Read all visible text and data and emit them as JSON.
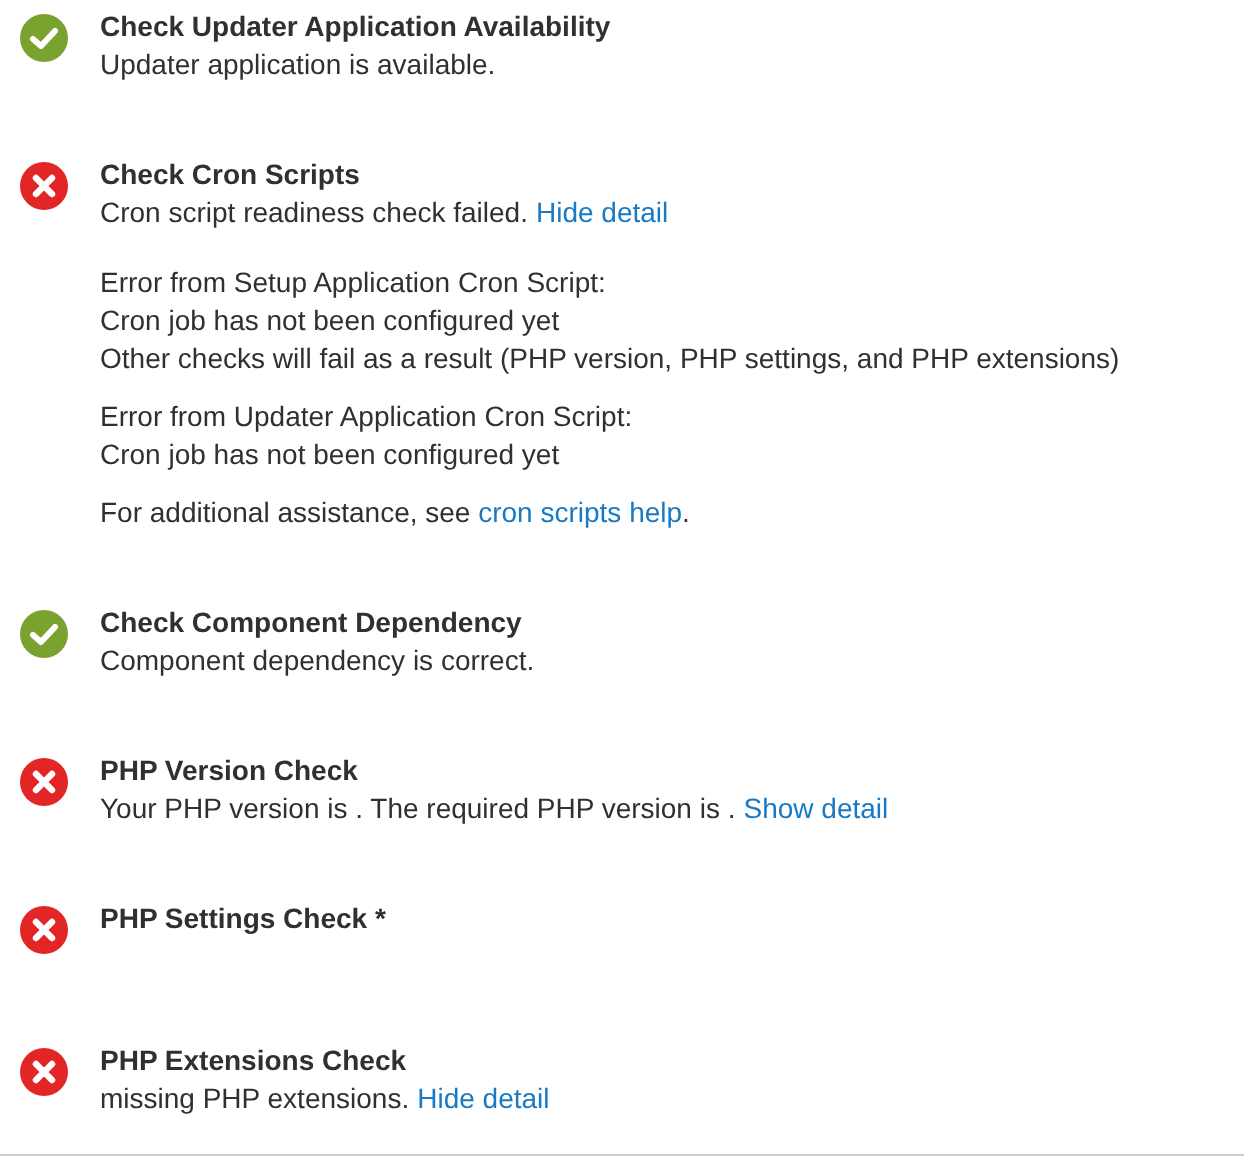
{
  "checks": [
    {
      "kind": "pass",
      "title": "Check Updater Application Availability",
      "message": "Updater application is available."
    },
    {
      "kind": "fail",
      "title": "Check Cron Scripts",
      "message": "Cron script readiness check failed.",
      "link": "Hide detail",
      "details": [
        {
          "lines": [
            "Error from Setup Application Cron Script:",
            "Cron job has not been configured yet",
            "Other checks will fail as a result (PHP version, PHP settings, and PHP extensions)"
          ]
        },
        {
          "lines": [
            "Error from Updater Application Cron Script:",
            "Cron job has not been configured yet"
          ]
        },
        {
          "text": "For additional assistance, see ",
          "link": "cron scripts help",
          "after": "."
        }
      ]
    },
    {
      "kind": "pass",
      "title": "Check Component Dependency",
      "message": "Component dependency is correct."
    },
    {
      "kind": "fail",
      "title": "PHP Version Check",
      "message": "Your PHP version is . The required PHP version is .",
      "link": "Show detail"
    },
    {
      "kind": "fail",
      "title": "PHP Settings Check *"
    },
    {
      "kind": "fail",
      "title": "PHP Extensions Check",
      "message": "missing PHP extensions.",
      "link": "Hide detail"
    }
  ]
}
